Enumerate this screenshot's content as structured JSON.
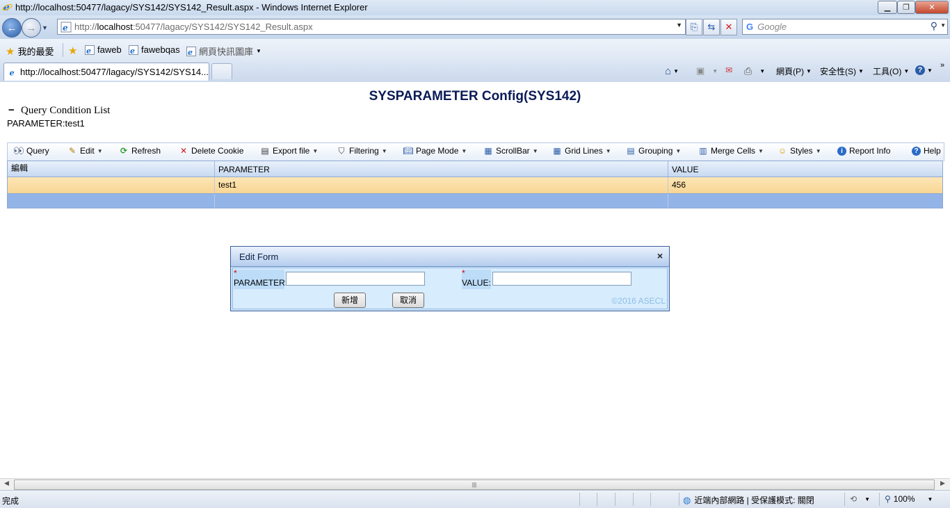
{
  "window": {
    "title": "http://localhost:50477/lagacy/SYS142/SYS142_Result.aspx - Windows Internet Explorer"
  },
  "address": {
    "url_prefix": "http://",
    "url_host": "localhost",
    "url_rest": ":50477/lagacy/SYS142/SYS142_Result.aspx",
    "search_placeholder": "Google",
    "search_logo": "G"
  },
  "favorites": {
    "favorites_label": "我的最愛",
    "links": [
      "faweb",
      "fawebqas",
      "網頁快訊圖庫"
    ]
  },
  "tabs": {
    "active_tab": "http://localhost:50477/lagacy/SYS142/SYS14..."
  },
  "commandbar": {
    "page": "網頁(P)",
    "safety": "安全性(S)",
    "tools": "工具(O)"
  },
  "page": {
    "title": "SYSPARAMETER Config(SYS142)",
    "query_toggle": "−",
    "query_title": "Query Condition List",
    "query_param": "PARAMETER:test1"
  },
  "toolbar": {
    "query": "Query",
    "edit": "Edit",
    "refresh": "Refresh",
    "delete_cookie": "Delete Cookie",
    "export": "Export file",
    "filtering": "Filtering",
    "page_mode": "Page Mode",
    "scrollbar": "ScrollBar",
    "grid_lines": "Grid Lines",
    "grouping": "Grouping",
    "merge_cells": "Merge Cells",
    "styles": "Styles",
    "report_info": "Report Info",
    "help": "Help"
  },
  "grid": {
    "headers": [
      "編輯",
      "PARAMETER",
      "VALUE"
    ],
    "rows": [
      [
        "",
        "test1",
        "456"
      ]
    ]
  },
  "dialog": {
    "title": "Edit Form",
    "close": "×",
    "required_mark": "*",
    "parameter_label": "PARAMETER:",
    "parameter_value": "",
    "value_label": "VALUE:",
    "value_value": "",
    "add_button": "新增",
    "cancel_button": "取消",
    "copyright": "©2016 ASECL"
  },
  "status": {
    "text": "完成",
    "zone": "近端內部網路 | 受保護模式: 關閉",
    "zoom": "100%"
  },
  "colors": {
    "selected_row": "#f8d694",
    "new_row": "#93b4e6",
    "title_text": "#0a1a56"
  }
}
